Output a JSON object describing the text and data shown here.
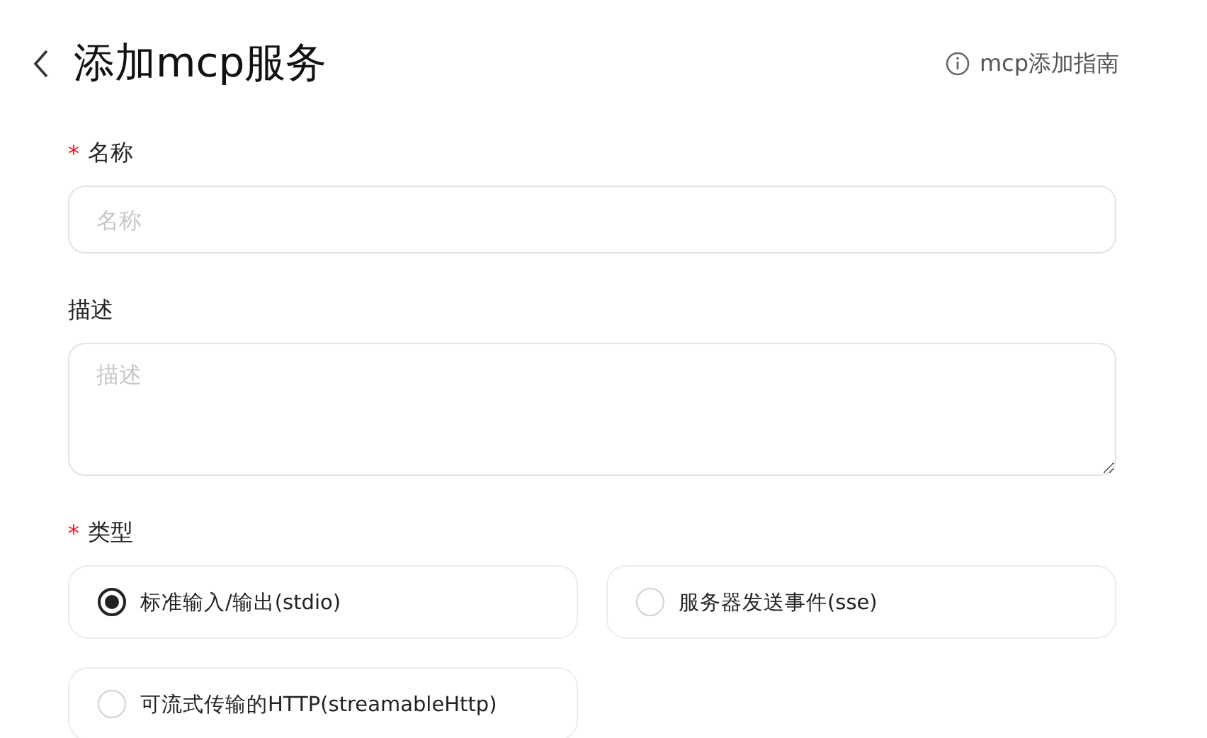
{
  "header": {
    "title": "添加mcp服务",
    "guide_link": "mcp添加指南"
  },
  "fields": [
    {
      "kind": "input",
      "label": "名称",
      "required_mark": "*",
      "placeholder": "名称"
    },
    {
      "kind": "textarea",
      "label": "描述",
      "placeholder": "描述"
    },
    {
      "kind": "radio",
      "label": "类型",
      "required_mark": "*",
      "options": [
        {
          "label": "标准输入/输出(stdio)",
          "selected": true
        },
        {
          "label": "服务器发送事件(sse)",
          "selected": false
        },
        {
          "label": "可流式传输的HTTP(streamableHttp)",
          "selected": false
        }
      ]
    }
  ]
}
